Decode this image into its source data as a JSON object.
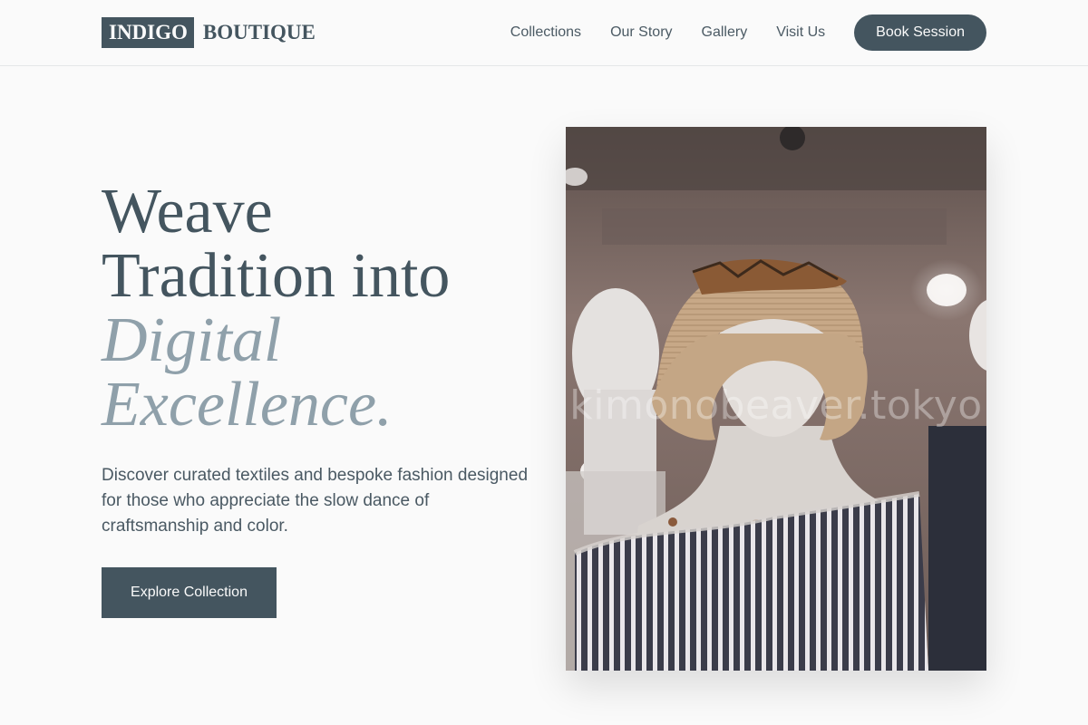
{
  "brand": {
    "part1": "INDIGO",
    "part2": "BOUTIQUE"
  },
  "nav": {
    "items": [
      {
        "label": "Collections"
      },
      {
        "label": "Our Story"
      },
      {
        "label": "Gallery"
      },
      {
        "label": "Visit Us"
      }
    ],
    "cta_label": "Book Session"
  },
  "hero": {
    "title_lines": [
      "Weave",
      "Tradition into"
    ],
    "title_accent_lines": [
      "Digital",
      "Excellence."
    ],
    "description": "Discover curated textiles and bespoke fashion designed for those who appreciate the slow dance of craftsmanship and color.",
    "cta_label": "Explore Collection"
  },
  "image": {
    "subject": "mannequin-with-straw-hat-and-striped-top",
    "watermark": "kimonobeaver.tokyo"
  },
  "colors": {
    "primary": "#44555f",
    "accent_text": "#8fa0aa",
    "background": "#fafafa"
  }
}
